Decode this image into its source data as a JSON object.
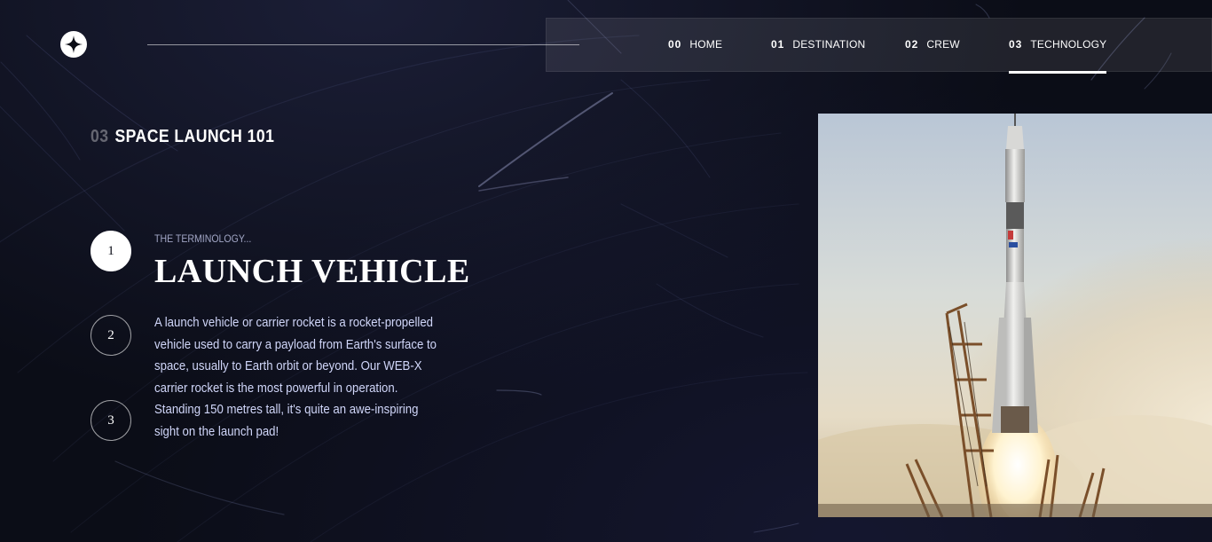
{
  "nav": {
    "items": [
      {
        "num": "00",
        "label": "HOME"
      },
      {
        "num": "01",
        "label": "DESTINATION"
      },
      {
        "num": "02",
        "label": "CREW"
      },
      {
        "num": "03",
        "label": "TECHNOLOGY"
      }
    ],
    "active": "TECHNOLOGY"
  },
  "page": {
    "heading_num": "03",
    "heading_text": "SPACE LAUNCH 101"
  },
  "steps": [
    "1",
    "2",
    "3"
  ],
  "active_step": "1",
  "technology": {
    "subtitle": "THE TERMINOLOGY...",
    "name": "LAUNCH VEHICLE",
    "description": "A launch vehicle or carrier rocket is a rocket-propelled vehicle used to carry a payload from Earth's surface to space, usually to Earth orbit or beyond. Our WEB-X carrier rocket is the most powerful in operation. Standing 150 metres tall, it's quite an awe-inspiring sight on the launch pad!"
  },
  "icons": {
    "logo": "star-logo-icon"
  },
  "colors": {
    "background": "#0b0d17",
    "text": "#ffffff",
    "muted_text": "#d0d6f9"
  }
}
